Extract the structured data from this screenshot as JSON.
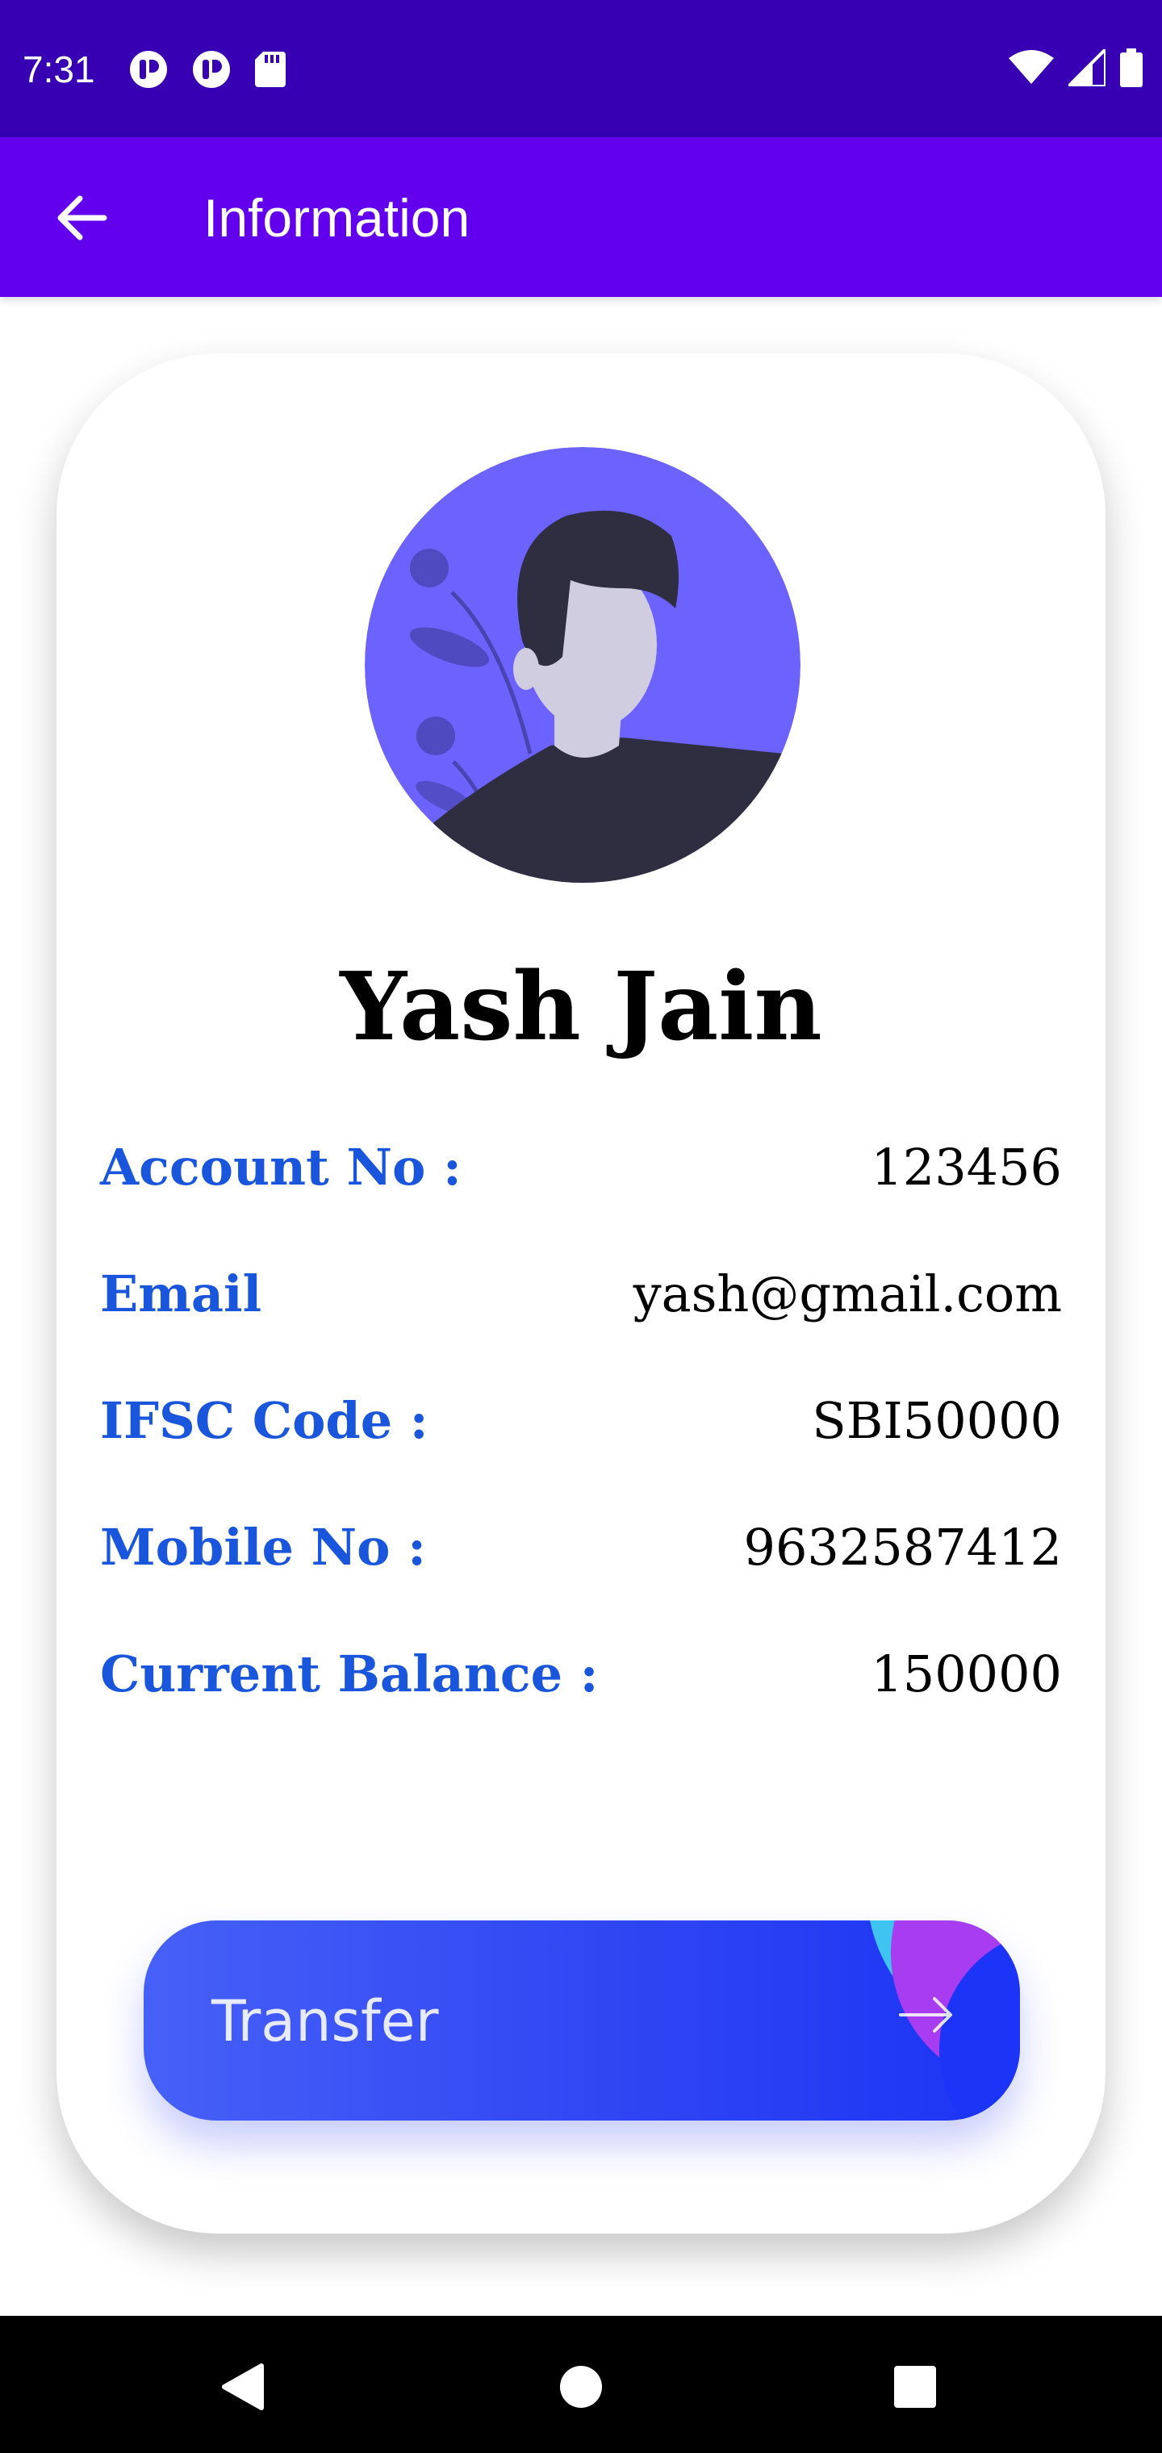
{
  "status_bar": {
    "time": "7:31",
    "left_icons": [
      "app-notification-icon",
      "app-notification-icon",
      "sd-card-icon"
    ],
    "right_icons": [
      "wifi-icon",
      "signal-icon",
      "battery-icon"
    ]
  },
  "app_bar": {
    "title": "Information",
    "back_icon": "arrow-back-icon"
  },
  "profile": {
    "name": "Yash Jain",
    "avatar_icon": "user-avatar-illustration"
  },
  "details": [
    {
      "label": "Account No :",
      "value": "123456"
    },
    {
      "label": "Email",
      "value": "yash@gmail.com"
    },
    {
      "label": "IFSC Code :",
      "value": "SBI50000"
    },
    {
      "label": "Mobile No :",
      "value": "9632587412"
    },
    {
      "label": "Current Balance :",
      "value": "150000"
    }
  ],
  "transfer_button": {
    "label": "Transfer",
    "icon": "arrow-right-icon"
  },
  "nav_bar": {
    "icons": [
      "back-triangle-icon",
      "home-circle-icon",
      "recents-square-icon"
    ]
  },
  "colors": {
    "status_bar": "#3700B3",
    "app_bar": "#6200EE",
    "label_blue": "#1A56DB",
    "avatar_bg": "#6C63FF",
    "button_blue": "#2F45F3"
  }
}
